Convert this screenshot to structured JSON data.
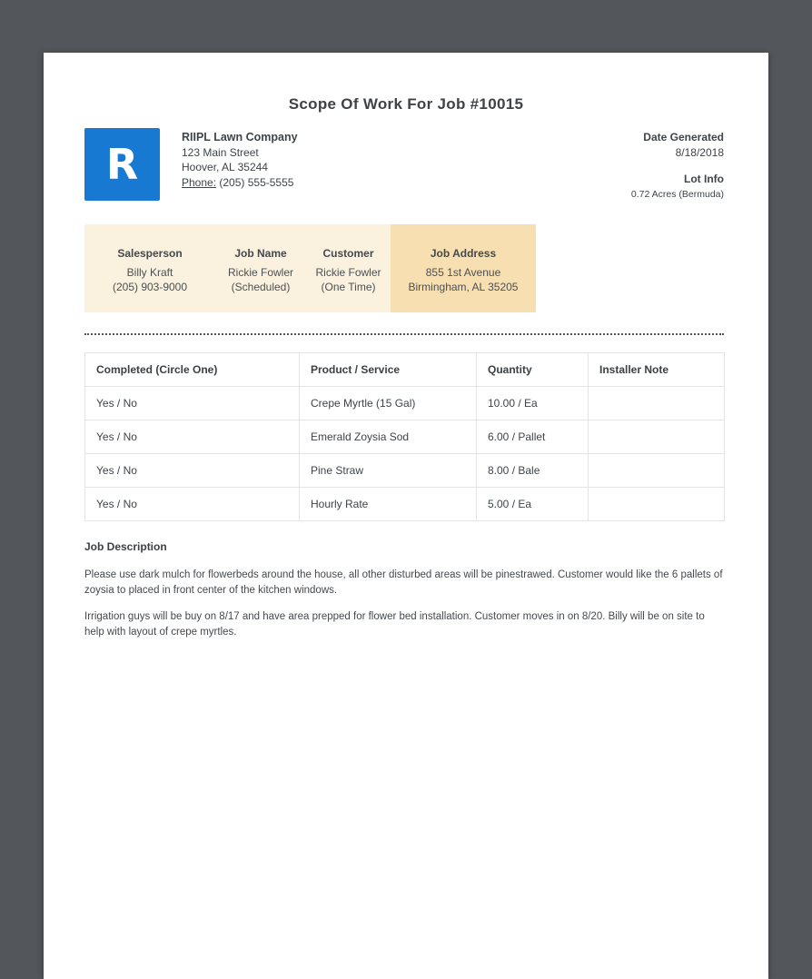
{
  "document": {
    "title": "Scope Of Work For Job #10015"
  },
  "company": {
    "logo_letter": "R",
    "name": "RIIPL Lawn Company",
    "address_line1": "123 Main Street",
    "address_line2": "Hoover, AL 35244",
    "phone_label": "Phone:",
    "phone": "(205) 555-5555"
  },
  "meta": {
    "date_generated_label": "Date Generated",
    "date_generated": "8/18/2018",
    "lot_info_label": "Lot Info",
    "lot_info": "0.72 Acres (Bermuda)"
  },
  "info_band": {
    "columns": [
      {
        "label": "Salesperson",
        "line1": "Billy Kraft",
        "line2": "(205) 903-9000"
      },
      {
        "label": "Job Name",
        "line1": "Rickie Fowler",
        "line2": "(Scheduled)"
      },
      {
        "label": "Customer",
        "line1": "Rickie Fowler",
        "line2": "(One Time)"
      },
      {
        "label": "Job Address",
        "line1": "855 1st Avenue",
        "line2": "Birmingham, AL 35205"
      }
    ]
  },
  "table": {
    "headers": [
      "Completed (Circle One)",
      "Product / Service",
      "Quantity",
      "Installer Note"
    ],
    "rows": [
      [
        "Yes / No",
        "Crepe Myrtle (15 Gal)",
        "10.00 / Ea",
        ""
      ],
      [
        "Yes / No",
        "Emerald Zoysia Sod",
        "6.00 / Pallet",
        ""
      ],
      [
        "Yes / No",
        "Pine Straw",
        "8.00 / Bale",
        ""
      ],
      [
        "Yes / No",
        "Hourly Rate",
        "5.00 / Ea",
        ""
      ]
    ]
  },
  "job_description": {
    "heading": "Job Description",
    "paragraph1": "Please use dark mulch for flowerbeds around the house, all other disturbed areas will be pinestrawed. Customer would like the 6 pallets of zoysia to placed in front center of the kitchen windows.",
    "paragraph2": "Irrigation guys will be buy on 8/17 and have area prepped for flower bed installation. Customer moves in on 8/20. Billy will be on site to help with layout of crepe myrtles."
  },
  "colors": {
    "backdrop": "#53565b",
    "page": "#ffffff",
    "logo_blue": "#1779d2",
    "band_cream": "#faf1de",
    "band_highlight_tan": "#f7dfb1",
    "text_dark": "#3f4449",
    "table_border": "#e3e4e5"
  }
}
